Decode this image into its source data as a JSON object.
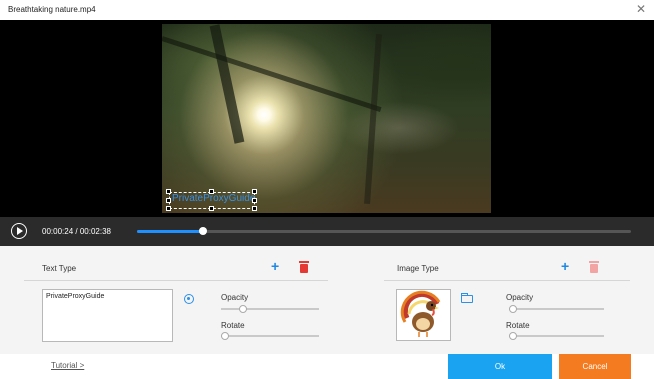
{
  "window": {
    "title": "Breathtaking nature.mp4",
    "close_icon": "close-icon"
  },
  "preview": {
    "overlay_text": "PrivateProxyGuide"
  },
  "player": {
    "current_time": "00:00:24",
    "separator": "/",
    "duration": "00:02:38",
    "progress_fraction": 0.134,
    "accent": "#1e90ff"
  },
  "text_type": {
    "title": "Text Type",
    "text_value": "PrivateProxyGuide",
    "opacity_label": "Opacity",
    "opacity_value": 0.18,
    "rotate_label": "Rotate",
    "rotate_value": 0.0
  },
  "image_type": {
    "title": "Image Type",
    "thumbnail": "turkey-image",
    "opacity_label": "Opacity",
    "opacity_value": 0.0,
    "rotate_label": "Rotate",
    "rotate_value": 0.0
  },
  "footer": {
    "tutorial_label": "Tutorial >",
    "ok_label": "Ok",
    "cancel_label": "Cancel"
  },
  "colors": {
    "ok": "#1aa3f0",
    "cancel": "#f47b20",
    "delete": "#e53935",
    "add": "#1e88e5"
  }
}
